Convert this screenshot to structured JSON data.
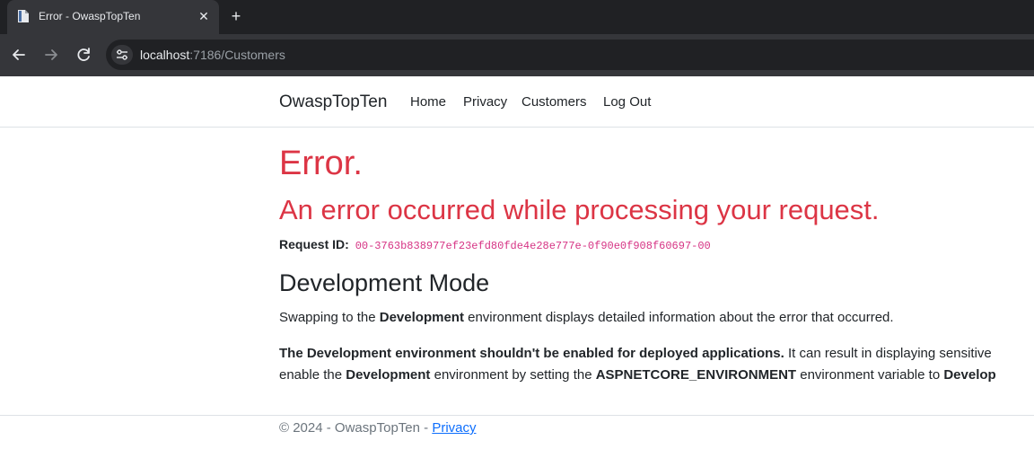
{
  "browser": {
    "tab_title": "Error - OwaspTopTen",
    "url_host": "localhost",
    "url_rest": ":7186/Customers"
  },
  "nav": {
    "brand": "OwaspTopTen",
    "links": [
      "Home",
      "Privacy",
      "Customers",
      "Log Out"
    ]
  },
  "error": {
    "title": "Error.",
    "subtitle": "An error occurred while processing your request.",
    "request_id_label": "Request ID:",
    "request_id": "00-3763b838977ef23efd80fde4e28e777e-0f90e0f908f60697-00"
  },
  "dev": {
    "heading": "Development Mode",
    "p1_a": "Swapping to the ",
    "p1_b": "Development",
    "p1_c": " environment displays detailed information about the error that occurred.",
    "p2_bold": "The Development environment shouldn't be enabled for deployed applications.",
    "p2_rest": " It can result in displaying sensitive",
    "p3_a": "enable the ",
    "p3_b": "Development",
    "p3_c": " environment by setting the ",
    "p3_d": "ASPNETCORE_ENVIRONMENT",
    "p3_e": " environment variable to ",
    "p3_f": "Develop"
  },
  "footer": {
    "text": "© 2024 - OwaspTopTen - ",
    "link": "Privacy"
  },
  "colors": {
    "error_red": "#dc3545",
    "code_pink": "#d63384",
    "link_blue": "#0d6efd"
  }
}
